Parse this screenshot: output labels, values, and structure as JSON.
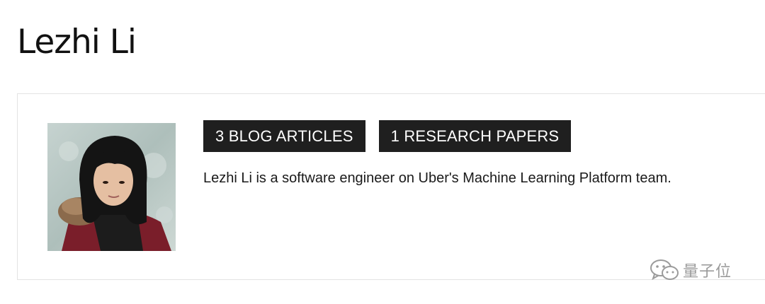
{
  "author": {
    "name": "Lezhi Li",
    "bio": "Lezhi Li is a software engineer on Uber's Machine Learning Platform team.",
    "badges": {
      "blog_articles": "3 BLOG ARTICLES",
      "research_papers": "1 RESEARCH PAPERS"
    },
    "avatar_icon": "author-photo"
  },
  "watermark": {
    "text": "量子位",
    "icon": "wechat-icon"
  },
  "colors": {
    "badge_background": "#1f1f1f",
    "badge_text": "#ffffff",
    "card_border": "#e3e3e3",
    "watermark": "#8a8a8a"
  }
}
